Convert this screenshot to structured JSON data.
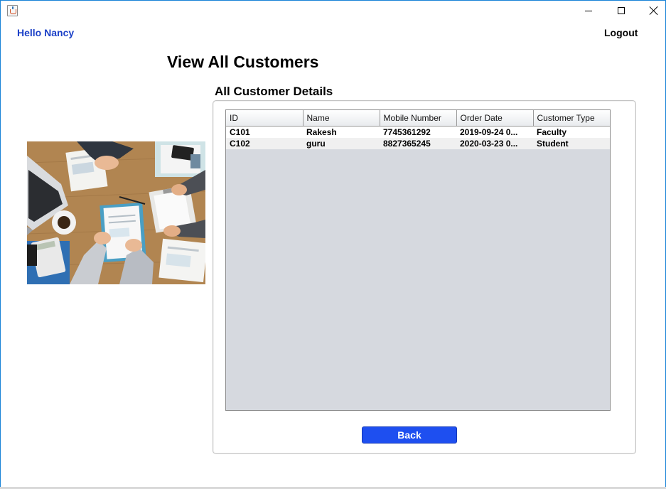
{
  "window": {
    "controls": [
      "minimize-icon",
      "maximize-icon",
      "close-icon"
    ]
  },
  "header": {
    "greeting": "Hello Nancy",
    "logout_label": "Logout"
  },
  "page": {
    "title": "View All Customers",
    "section_title": "All Customer Details"
  },
  "table": {
    "columns": [
      "ID",
      "Name",
      "Mobile Number",
      "Order Date",
      "Customer Type"
    ],
    "rows": [
      [
        "C101",
        "Rakesh",
        "7745361292",
        "2019-09-24 0...",
        "Faculty"
      ],
      [
        "C102",
        "guru",
        "8827365245",
        "2020-03-23 0...",
        "Student"
      ]
    ]
  },
  "actions": {
    "back_label": "Back"
  },
  "colors": {
    "accent": "#1e4ff0",
    "greeting": "#1a3fc7",
    "table_background": "#d6d9df"
  }
}
